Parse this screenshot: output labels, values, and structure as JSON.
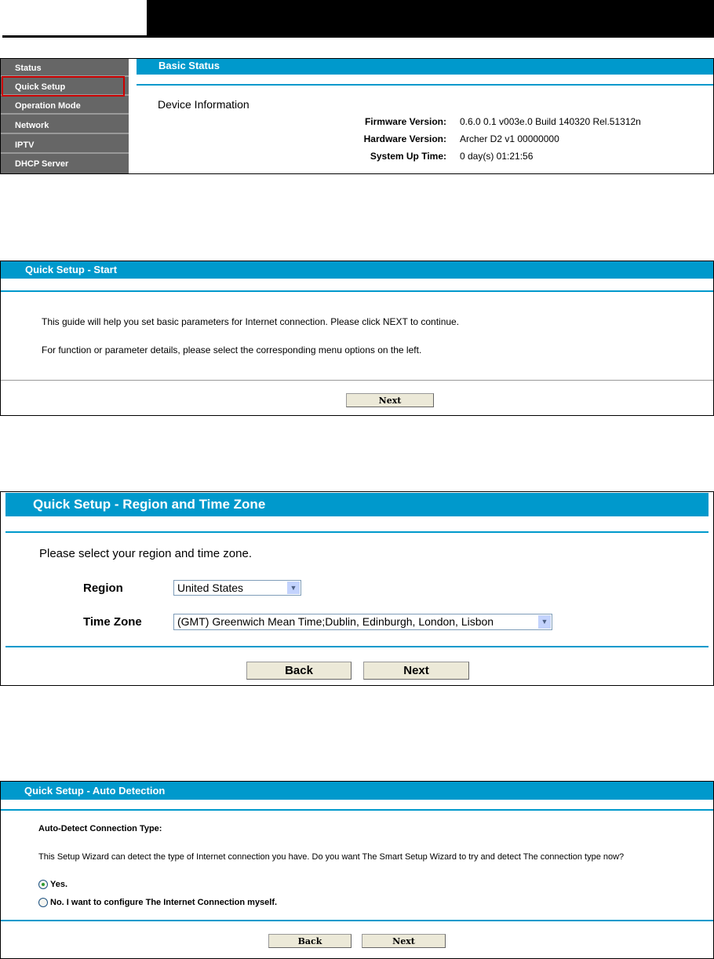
{
  "status_panel": {
    "sidebar": [
      "Status",
      "Quick Setup",
      "Operation Mode",
      "Network",
      "IPTV",
      "DHCP Server"
    ],
    "header": "Basic Status",
    "section_title": "Device Information",
    "rows": [
      {
        "label": "Firmware Version:",
        "value": "0.6.0 0.1 v003e.0 Build 140320 Rel.51312n"
      },
      {
        "label": "Hardware Version:",
        "value": "Archer D2 v1 00000000"
      },
      {
        "label": "System Up Time:",
        "value": "0 day(s) 01:21:56"
      }
    ],
    "highlight_color": "#cc0000"
  },
  "start_panel": {
    "header": "Quick Setup - Start",
    "line1": "This guide will help you set basic parameters for Internet connection. Please click NEXT to continue.",
    "line2": "For function or parameter details, please select the corresponding menu options on the left.",
    "next": "Next"
  },
  "region_panel": {
    "header": "Quick Setup - Region and Time Zone",
    "intro": "Please select your region and time zone.",
    "region_label": "Region",
    "region_value": "United States",
    "tz_label": "Time Zone",
    "tz_value": "(GMT) Greenwich Mean Time;Dublin, Edinburgh, London, Lisbon",
    "back": "Back",
    "next": "Next"
  },
  "auto_panel": {
    "header": "Quick Setup - Auto Detection",
    "subtitle": "Auto-Detect Connection Type:",
    "desc": "This Setup Wizard can detect the type of Internet connection you have. Do you want The Smart Setup Wizard to try and detect The connection type now?",
    "opt_yes": "Yes.",
    "opt_no": "No. I want to configure The Internet Connection myself.",
    "back": "Back",
    "next": "Next"
  },
  "colors": {
    "accent": "#0099cc",
    "sidebar": "#666666",
    "button": "#ece9d8"
  }
}
